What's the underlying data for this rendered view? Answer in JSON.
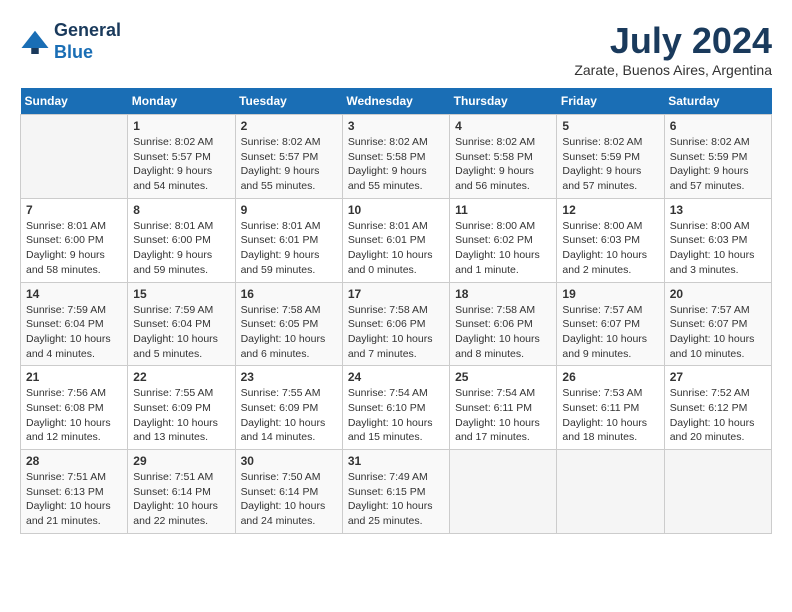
{
  "header": {
    "logo_line1": "General",
    "logo_line2": "Blue",
    "month_title": "July 2024",
    "location": "Zarate, Buenos Aires, Argentina"
  },
  "calendar": {
    "days_of_week": [
      "Sunday",
      "Monday",
      "Tuesday",
      "Wednesday",
      "Thursday",
      "Friday",
      "Saturday"
    ],
    "weeks": [
      [
        {
          "day": "",
          "info": ""
        },
        {
          "day": "1",
          "info": "Sunrise: 8:02 AM\nSunset: 5:57 PM\nDaylight: 9 hours\nand 54 minutes."
        },
        {
          "day": "2",
          "info": "Sunrise: 8:02 AM\nSunset: 5:57 PM\nDaylight: 9 hours\nand 55 minutes."
        },
        {
          "day": "3",
          "info": "Sunrise: 8:02 AM\nSunset: 5:58 PM\nDaylight: 9 hours\nand 55 minutes."
        },
        {
          "day": "4",
          "info": "Sunrise: 8:02 AM\nSunset: 5:58 PM\nDaylight: 9 hours\nand 56 minutes."
        },
        {
          "day": "5",
          "info": "Sunrise: 8:02 AM\nSunset: 5:59 PM\nDaylight: 9 hours\nand 57 minutes."
        },
        {
          "day": "6",
          "info": "Sunrise: 8:02 AM\nSunset: 5:59 PM\nDaylight: 9 hours\nand 57 minutes."
        }
      ],
      [
        {
          "day": "7",
          "info": "Sunrise: 8:01 AM\nSunset: 6:00 PM\nDaylight: 9 hours\nand 58 minutes."
        },
        {
          "day": "8",
          "info": "Sunrise: 8:01 AM\nSunset: 6:00 PM\nDaylight: 9 hours\nand 59 minutes."
        },
        {
          "day": "9",
          "info": "Sunrise: 8:01 AM\nSunset: 6:01 PM\nDaylight: 9 hours\nand 59 minutes."
        },
        {
          "day": "10",
          "info": "Sunrise: 8:01 AM\nSunset: 6:01 PM\nDaylight: 10 hours\nand 0 minutes."
        },
        {
          "day": "11",
          "info": "Sunrise: 8:00 AM\nSunset: 6:02 PM\nDaylight: 10 hours\nand 1 minute."
        },
        {
          "day": "12",
          "info": "Sunrise: 8:00 AM\nSunset: 6:03 PM\nDaylight: 10 hours\nand 2 minutes."
        },
        {
          "day": "13",
          "info": "Sunrise: 8:00 AM\nSunset: 6:03 PM\nDaylight: 10 hours\nand 3 minutes."
        }
      ],
      [
        {
          "day": "14",
          "info": "Sunrise: 7:59 AM\nSunset: 6:04 PM\nDaylight: 10 hours\nand 4 minutes."
        },
        {
          "day": "15",
          "info": "Sunrise: 7:59 AM\nSunset: 6:04 PM\nDaylight: 10 hours\nand 5 minutes."
        },
        {
          "day": "16",
          "info": "Sunrise: 7:58 AM\nSunset: 6:05 PM\nDaylight: 10 hours\nand 6 minutes."
        },
        {
          "day": "17",
          "info": "Sunrise: 7:58 AM\nSunset: 6:06 PM\nDaylight: 10 hours\nand 7 minutes."
        },
        {
          "day": "18",
          "info": "Sunrise: 7:58 AM\nSunset: 6:06 PM\nDaylight: 10 hours\nand 8 minutes."
        },
        {
          "day": "19",
          "info": "Sunrise: 7:57 AM\nSunset: 6:07 PM\nDaylight: 10 hours\nand 9 minutes."
        },
        {
          "day": "20",
          "info": "Sunrise: 7:57 AM\nSunset: 6:07 PM\nDaylight: 10 hours\nand 10 minutes."
        }
      ],
      [
        {
          "day": "21",
          "info": "Sunrise: 7:56 AM\nSunset: 6:08 PM\nDaylight: 10 hours\nand 12 minutes."
        },
        {
          "day": "22",
          "info": "Sunrise: 7:55 AM\nSunset: 6:09 PM\nDaylight: 10 hours\nand 13 minutes."
        },
        {
          "day": "23",
          "info": "Sunrise: 7:55 AM\nSunset: 6:09 PM\nDaylight: 10 hours\nand 14 minutes."
        },
        {
          "day": "24",
          "info": "Sunrise: 7:54 AM\nSunset: 6:10 PM\nDaylight: 10 hours\nand 15 minutes."
        },
        {
          "day": "25",
          "info": "Sunrise: 7:54 AM\nSunset: 6:11 PM\nDaylight: 10 hours\nand 17 minutes."
        },
        {
          "day": "26",
          "info": "Sunrise: 7:53 AM\nSunset: 6:11 PM\nDaylight: 10 hours\nand 18 minutes."
        },
        {
          "day": "27",
          "info": "Sunrise: 7:52 AM\nSunset: 6:12 PM\nDaylight: 10 hours\nand 20 minutes."
        }
      ],
      [
        {
          "day": "28",
          "info": "Sunrise: 7:51 AM\nSunset: 6:13 PM\nDaylight: 10 hours\nand 21 minutes."
        },
        {
          "day": "29",
          "info": "Sunrise: 7:51 AM\nSunset: 6:14 PM\nDaylight: 10 hours\nand 22 minutes."
        },
        {
          "day": "30",
          "info": "Sunrise: 7:50 AM\nSunset: 6:14 PM\nDaylight: 10 hours\nand 24 minutes."
        },
        {
          "day": "31",
          "info": "Sunrise: 7:49 AM\nSunset: 6:15 PM\nDaylight: 10 hours\nand 25 minutes."
        },
        {
          "day": "",
          "info": ""
        },
        {
          "day": "",
          "info": ""
        },
        {
          "day": "",
          "info": ""
        }
      ]
    ]
  }
}
